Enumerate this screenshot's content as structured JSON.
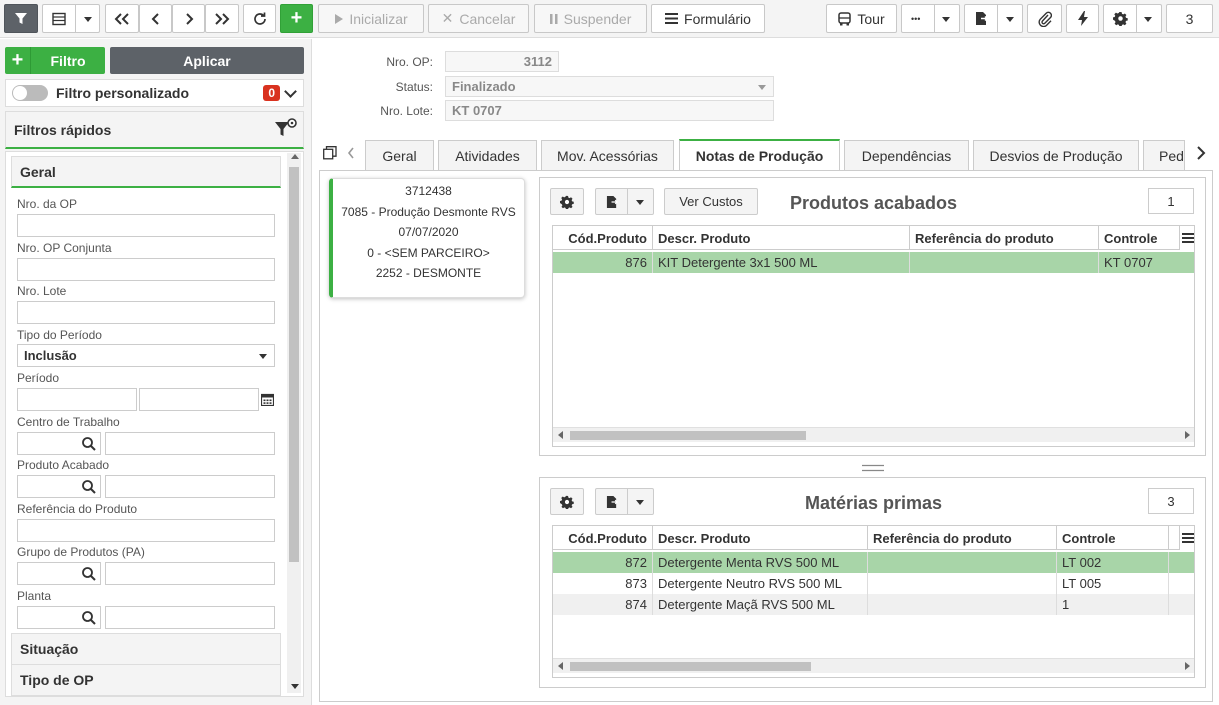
{
  "toolbar": {
    "inicializar": "Inicializar",
    "cancelar": "Cancelar",
    "suspender": "Suspender",
    "formulario": "Formulário",
    "tour": "Tour",
    "more": "•••",
    "counter": "3"
  },
  "left": {
    "filtro_label": "Filtro",
    "aplicar_label": "Aplicar",
    "filtro_personalizado": "Filtro personalizado",
    "filtro_count": "0",
    "filtros_rapidos": "Filtros rápidos",
    "groups": {
      "geral": "Geral",
      "situacao": "Situação",
      "tipo_op": "Tipo de OP"
    },
    "fields": {
      "nro_op": "Nro. da OP",
      "nro_op_conjunta": "Nro. OP Conjunta",
      "nro_lote": "Nro. Lote",
      "tipo_periodo": "Tipo do Período",
      "tipo_periodo_value": "Inclusão",
      "periodo": "Período",
      "centro_trabalho": "Centro de Trabalho",
      "produto_acabado": "Produto Acabado",
      "referencia_produto": "Referência do Produto",
      "grupo_produtos": "Grupo de Produtos (PA)",
      "planta": "Planta"
    }
  },
  "header": {
    "nro_op_label": "Nro. OP:",
    "nro_op_value": "3112",
    "status_label": "Status:",
    "status_value": "Finalizado",
    "nro_lote_label": "Nro. Lote:",
    "nro_lote_value": "KT 0707"
  },
  "tabs": [
    "Geral",
    "Atividades",
    "Mov. Acessórias",
    "Notas de Produção",
    "Dependências",
    "Desvios de Produção",
    "Ped"
  ],
  "card": {
    "line1": "3712438",
    "line2": "7085 - Produção Desmonte RVS",
    "line3": "07/07/2020",
    "line4": "0 - <SEM PARCEIRO>",
    "line5": "2252 - DESMONTE"
  },
  "acabados": {
    "title": "Produtos acabados",
    "ver_custos": "Ver Custos",
    "count": "1",
    "columns": [
      "Cód.Produto",
      "Descr. Produto",
      "Referência do produto",
      "Controle"
    ],
    "rows": [
      {
        "cod": "876",
        "descr": "KIT Detergente 3x1 500 ML",
        "ref": "",
        "ctrl": "KT 0707"
      }
    ]
  },
  "primas": {
    "title": "Matérias primas",
    "count": "3",
    "columns": [
      "Cód.Produto",
      "Descr. Produto",
      "Referência do produto",
      "Controle"
    ],
    "rows": [
      {
        "cod": "872",
        "descr": "Detergente Menta RVS 500 ML",
        "ref": "",
        "ctrl": "LT 002"
      },
      {
        "cod": "873",
        "descr": "Detergente Neutro RVS 500 ML",
        "ref": "",
        "ctrl": "LT 005"
      },
      {
        "cod": "874",
        "descr": "Detergente Maçã RVS 500 ML",
        "ref": "",
        "ctrl": "1"
      }
    ]
  },
  "colors": {
    "accent": "#3cb043",
    "dark": "#5d6268",
    "badge": "#d9321f",
    "row_selected": "#a8d5a8"
  }
}
